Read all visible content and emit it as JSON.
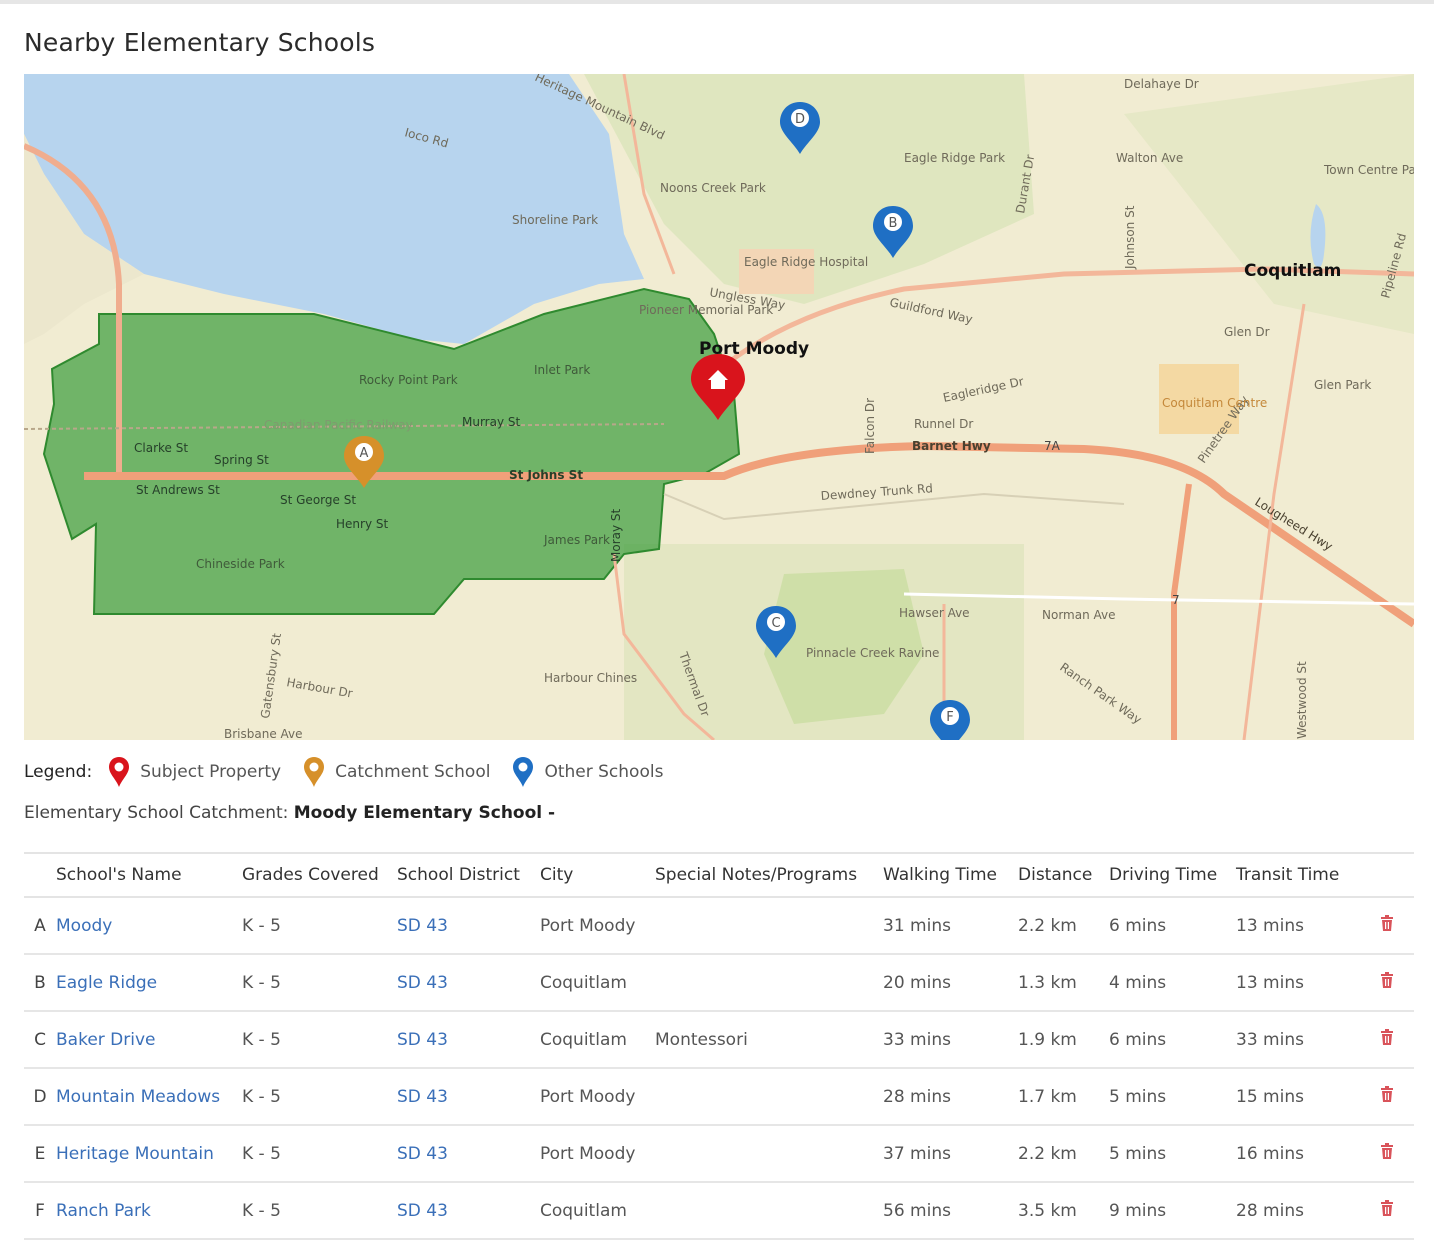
{
  "page": {
    "title": "Nearby Elementary Schools"
  },
  "map": {
    "labels": {
      "port_moody": "Port Moody",
      "coquitlam": "Coquitlam",
      "ioco_rd": "Ioco Rd",
      "heritage_mountain_blvd": "Heritage Mountain Blvd",
      "shoreline_park": "Shoreline Park",
      "noons_creek_park": "Noons Creek Park",
      "eagle_ridge_park": "Eagle Ridge Park",
      "eagle_ridge_hospital": "Eagle Ridge Hospital",
      "guildford_way": "Guildford Way",
      "walton_ave": "Walton Ave",
      "glen_dr": "Glen Dr",
      "barnet_hwy": "Barnet Hwy",
      "st_johns_st": "St Johns St",
      "murray_st": "Murray St",
      "clarke_st": "Clarke St",
      "spring_st": "Spring St",
      "st_andrews_st": "St Andrews St",
      "st_george_st": "St George St",
      "henry_st": "Henry St",
      "inlet_park": "Inlet Park",
      "rocky_point_park": "Rocky Point Park",
      "canadian_pacific_railway": "Canadian Pacific Railway",
      "dewdney_trunk_rd": "Dewdney Trunk Rd",
      "lougheed_hwy": "Lougheed Hwy",
      "pinetree_way": "Pinetree Way",
      "coquitlam_centre": "Coquitlam Centre",
      "hawser_ave": "Hawser Ave",
      "norman_ave": "Norman Ave",
      "pinnacle_creek_ravine": "Pinnacle Creek Ravine",
      "harbour_dr": "Harbour Dr",
      "brisbane_ave": "Brisbane Ave",
      "james_park": "James Park",
      "chineside_park": "Chineside Park",
      "eagleridge_dr": "Eagleridge Dr",
      "runnel_dr": "Runnel Dr",
      "ungless_way": "Ungless Way",
      "johnson_st": "Johnson St",
      "pipeline_rd": "Pipeline Rd",
      "town_centre_park": "Town Centre Park",
      "glen_park": "Glen Park",
      "pioneer_memorial_park": "Pioneer Memorial Park",
      "moray_st": "Moray St",
      "falcon_dr": "Falcon Dr",
      "durant_dr": "Durant Dr",
      "delahaye_dr": "Delahaye Dr",
      "harbour_chines": "Harbour Chines",
      "ranch_park_way": "Ranch Park Way",
      "westwood_st": "Westwood St",
      "gatensbury_st": "Gatensbury St",
      "thermal_dr": "Thermal Dr",
      "route_7a": "7A",
      "route_7": "7"
    },
    "markers": [
      {
        "letter": "A",
        "type": "catchment"
      },
      {
        "letter": "B",
        "type": "other"
      },
      {
        "letter": "C",
        "type": "other"
      },
      {
        "letter": "D",
        "type": "other"
      },
      {
        "letter": "F",
        "type": "other"
      }
    ],
    "colors": {
      "subject": "#d9141c",
      "catchment": "#d6902a",
      "other": "#1f6fc4",
      "catchment_area": "#3f9e3f"
    }
  },
  "legend": {
    "label": "Legend:",
    "subject": "Subject Property",
    "catchment": "Catchment School",
    "other": "Other Schools"
  },
  "catchment": {
    "prefix": "Elementary School Catchment:",
    "name": "Moody Elementary School -"
  },
  "table": {
    "headers": [
      "School's Name",
      "Grades Covered",
      "School District",
      "City",
      "Special Notes/Programs",
      "Walking Time",
      "Distance",
      "Driving Time",
      "Transit Time"
    ],
    "rows": [
      {
        "letter": "A",
        "name": "Moody",
        "grades": "K - 5",
        "district": "SD 43",
        "city": "Port Moody",
        "notes": "",
        "walking": "31 mins",
        "distance": "2.2 km",
        "driving": "6 mins",
        "transit": "13 mins"
      },
      {
        "letter": "B",
        "name": "Eagle Ridge",
        "grades": "K - 5",
        "district": "SD 43",
        "city": "Coquitlam",
        "notes": "",
        "walking": "20 mins",
        "distance": "1.3 km",
        "driving": "4 mins",
        "transit": "13 mins"
      },
      {
        "letter": "C",
        "name": "Baker Drive",
        "grades": "K - 5",
        "district": "SD 43",
        "city": "Coquitlam",
        "notes": "Montessori",
        "walking": "33 mins",
        "distance": "1.9 km",
        "driving": "6 mins",
        "transit": "33 mins"
      },
      {
        "letter": "D",
        "name": "Mountain Meadows",
        "grades": "K - 5",
        "district": "SD 43",
        "city": "Port Moody",
        "notes": "",
        "walking": "28 mins",
        "distance": "1.7 km",
        "driving": "5 mins",
        "transit": "15 mins"
      },
      {
        "letter": "E",
        "name": "Heritage Mountain",
        "grades": "K - 5",
        "district": "SD 43",
        "city": "Port Moody",
        "notes": "",
        "walking": "37 mins",
        "distance": "2.2 km",
        "driving": "5 mins",
        "transit": "16 mins"
      },
      {
        "letter": "F",
        "name": "Ranch Park",
        "grades": "K - 5",
        "district": "SD 43",
        "city": "Coquitlam",
        "notes": "",
        "walking": "56 mins",
        "distance": "3.5 km",
        "driving": "9 mins",
        "transit": "28 mins"
      }
    ],
    "delete_icon": "trash-icon"
  }
}
